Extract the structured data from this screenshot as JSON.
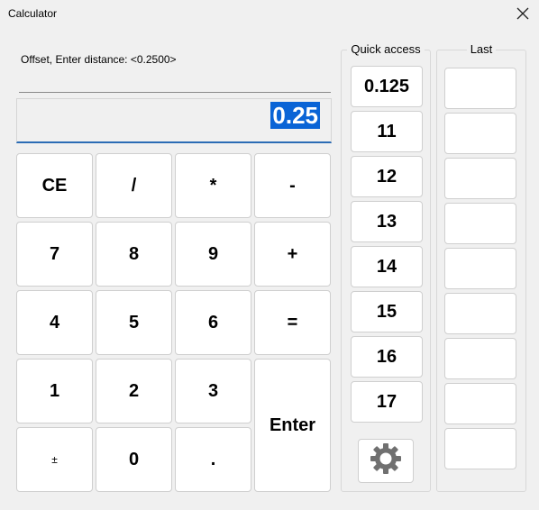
{
  "window": {
    "title": "Calculator",
    "close_icon": "close-icon"
  },
  "prompt": {
    "text": "Offset, Enter distance:  <0.2500>"
  },
  "display": {
    "value": "0.25",
    "selection_color": "#0a64d6",
    "underline_color": "#2b6cb5"
  },
  "keypad": {
    "ce": "CE",
    "divide": "/",
    "multiply": "*",
    "minus": "-",
    "seven": "7",
    "eight": "8",
    "nine": "9",
    "plus": "+",
    "four": "4",
    "five": "5",
    "six": "6",
    "equals": "=",
    "one": "1",
    "two": "2",
    "three": "3",
    "enter": "Enter",
    "plusminus": "±",
    "zero": "0",
    "decimal": "."
  },
  "quick_access": {
    "label": "Quick access",
    "values": [
      "0.125",
      "11",
      "12",
      "13",
      "14",
      "15",
      "16",
      "17"
    ],
    "settings_icon": "gear-icon"
  },
  "last": {
    "label": "Last",
    "slots": [
      "",
      "",
      "",
      "",
      "",
      "",
      "",
      "",
      ""
    ]
  }
}
